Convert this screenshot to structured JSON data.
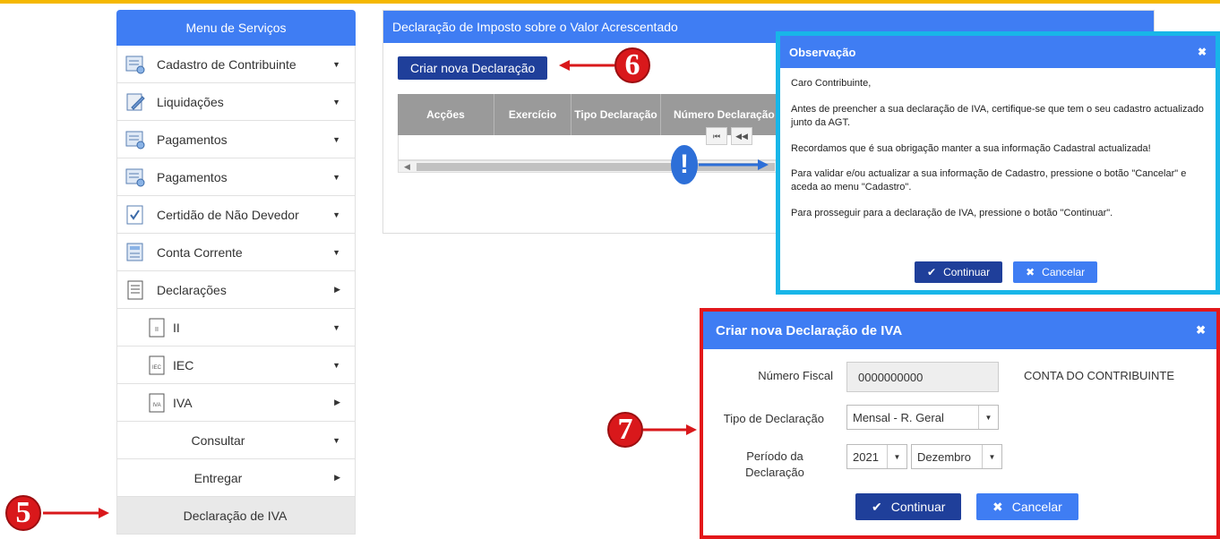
{
  "menu": {
    "title": "Menu de Serviços",
    "items": [
      {
        "label": "Cadastro de Contribuinte",
        "icon": "form-icon",
        "caret": "▼"
      },
      {
        "label": "Liquidações",
        "icon": "edit-doc-icon",
        "caret": "▼"
      },
      {
        "label": "Pagamentos",
        "icon": "form-icon",
        "caret": "▼"
      },
      {
        "label": "Pagamentos",
        "icon": "form-icon",
        "caret": "▼"
      },
      {
        "label": "Certidão de Não Devedor",
        "icon": "certificate-icon",
        "caret": "▼"
      },
      {
        "label": "Conta Corrente",
        "icon": "ledger-icon",
        "caret": "▼"
      },
      {
        "label": "Declarações",
        "icon": "document-icon",
        "caret": "▶"
      },
      {
        "label": "II",
        "icon": "doc-ii-icon",
        "caret": "▼"
      },
      {
        "label": "IEC",
        "icon": "doc-iec-icon",
        "caret": "▼"
      },
      {
        "label": "IVA",
        "icon": "doc-iva-icon",
        "caret": "▶"
      },
      {
        "label": "Consultar",
        "caret": "▼"
      },
      {
        "label": "Entregar",
        "caret": "▶"
      },
      {
        "label": "Declaração de IVA"
      }
    ]
  },
  "main": {
    "title": "Declaração de Imposto sobre o Valor Acrescentado",
    "new_button": "Criar nova Declaração",
    "columns": [
      "Acções",
      "Exercício",
      "Tipo Declaração",
      "Número Declaração"
    ],
    "pager": [
      "⏮",
      "◀◀"
    ]
  },
  "obs_dialog": {
    "title": "Observação",
    "close": "✖",
    "paragraphs": [
      "Caro Contribuinte,",
      "Antes de preencher a sua declaração de IVA, certifique-se que tem o seu cadastro actualizado junto da AGT.",
      "Recordamos que é sua obrigação manter a sua informação Cadastral actualizada!",
      "Para validar e/ou actualizar a sua informação de Cadastro, pressione o botão \"Cancelar\" e aceda ao menu \"Cadastro\".",
      "Para prosseguir para a declaração de IVA, pressione o botão \"Continuar\"."
    ],
    "continue": "Continuar",
    "cancel": "Cancelar"
  },
  "new_dialog": {
    "title": "Criar nova Declaração de IVA",
    "close": "✖",
    "nif_label": "Número Fiscal",
    "nif_value": "0000000000",
    "account_label": "CONTA DO CONTRIBUINTE",
    "type_label": "Tipo de Declaração",
    "type_value": "Mensal - R. Geral",
    "period_label": "Período da Declaração",
    "year_value": "2021",
    "month_value": "Dezembro",
    "continue": "Continuar",
    "cancel": "Cancelar"
  },
  "annotations": {
    "step5": "5",
    "step6": "6",
    "step7": "7",
    "alert": "!"
  },
  "colors": {
    "primary": "#3f7df3",
    "dark_button": "#1f3f9a",
    "annotation_red": "#d9181b",
    "highlight_cyan": "#18b6e8"
  }
}
